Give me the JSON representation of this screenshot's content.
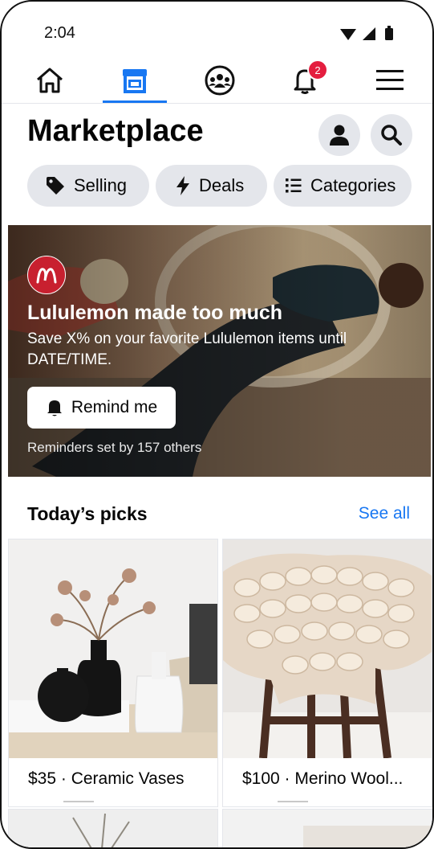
{
  "status": {
    "time": "2:04"
  },
  "nav": {
    "notification_count": "2"
  },
  "header": {
    "title": "Marketplace"
  },
  "chips": {
    "selling": "Selling",
    "deals": "Deals",
    "categories": "Categories"
  },
  "banner": {
    "title": "Lululemon made too much",
    "subtitle": "Save X% on your favorite Lululemon items until DATE/TIME.",
    "button_label": "Remind me",
    "note": "Reminders set by 157 others"
  },
  "picks": {
    "title": "Today’s picks",
    "see_all": "See all",
    "items": [
      {
        "label": "$35 · Ceramic Vases"
      },
      {
        "label": "$100 · Merino Wool..."
      }
    ]
  },
  "colors": {
    "accent": "#1877f2",
    "badge": "#e41e3f",
    "chip_bg": "#e4e6eb",
    "brand": "#c8202f"
  }
}
